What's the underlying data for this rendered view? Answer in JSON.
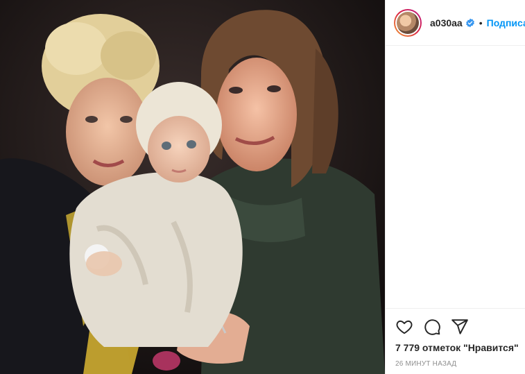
{
  "post": {
    "username": "a030aa",
    "follow_label": "Подписа",
    "separator": "•",
    "likes_text": "7 779 отметок \"Нравится\"",
    "timestamp": "26 минут назад"
  },
  "icons": {
    "verified": "verified-badge-icon",
    "like": "heart-icon",
    "comment": "comment-icon",
    "share": "share-icon"
  },
  "colors": {
    "accent": "#0095f6",
    "verified": "#3897f0",
    "text": "#262626",
    "muted": "#8e8e8e"
  }
}
